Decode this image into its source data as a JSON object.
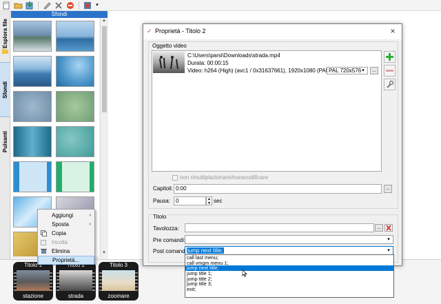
{
  "toolbar": {
    "icons": [
      "new-file-icon",
      "open-folder-icon",
      "import-icon",
      "pen-icon",
      "tools-icon",
      "stop-icon",
      "burn-icon",
      "dropdown-icon"
    ]
  },
  "left_tabs": {
    "explorer": "Esplora file",
    "backgrounds": "Sfondi",
    "buttons": "Pulsanti"
  },
  "panel": {
    "header": "Sfondi"
  },
  "context_menu": {
    "items": [
      {
        "label": "Aggiungi",
        "submenu": true,
        "disabled": false
      },
      {
        "label": "Sposta",
        "submenu": true,
        "disabled": false
      },
      {
        "label": "Copia",
        "submenu": false,
        "disabled": false
      },
      {
        "label": "Incolla",
        "submenu": false,
        "disabled": true
      },
      {
        "label": "Elimina",
        "submenu": false,
        "disabled": false
      },
      {
        "label": "Proprietà...",
        "submenu": false,
        "disabled": false,
        "highlighted": true
      }
    ],
    "submenu_arrow": "›"
  },
  "titles": [
    {
      "header": "Titolo 1",
      "caption": "stazione"
    },
    {
      "header": "Titolo 2",
      "caption": "strada"
    },
    {
      "header": "Titolo 3",
      "caption": "zoomare"
    }
  ],
  "dialog": {
    "title": "Proprietà - Titolo 2",
    "close": "×",
    "video_group_label": "Oggetto video",
    "video": {
      "path": "C:\\Users\\parsi\\Downloads\\strada.mp4",
      "duration": "Durata: 00:00:15",
      "info": "Video: h264 (High) (avc1 / 0x31637661), 1920x1080 (PAL), 16:9",
      "format": "PAL 720x576",
      "more_button": "..."
    },
    "no_remux_label": "non rimultiplazionare/transcodificare",
    "chapters_label": "Capitoli:",
    "chapters_value": "0:00",
    "chapters_button": "...",
    "pause_label": "Pausa:",
    "pause_value": "0",
    "pause_unit": "sec",
    "title_group_label": "Titolo",
    "palette_label": "Tavolozza:",
    "palette_value": "",
    "palette_button": "...",
    "pre_commands_label": "Pre comandi:",
    "pre_commands_value": "",
    "post_commands_label": "Post comandi:",
    "post_commands_value": "jump next title;",
    "dropdown_arrow": "▼"
  },
  "post_commands_options": [
    "call last menu;",
    "call vmgm menu 1;",
    "jump next title;",
    "jump title 1;",
    "jump title 2;",
    "jump title 3;",
    "exit;"
  ],
  "post_commands_selected": "jump next title;",
  "colors": {
    "accent": "#2a73c9",
    "selection": "#0078d7",
    "menu_highlight": "#cce4f7",
    "add_green": "#2faa3a",
    "remove_red": "#d23a3a"
  }
}
